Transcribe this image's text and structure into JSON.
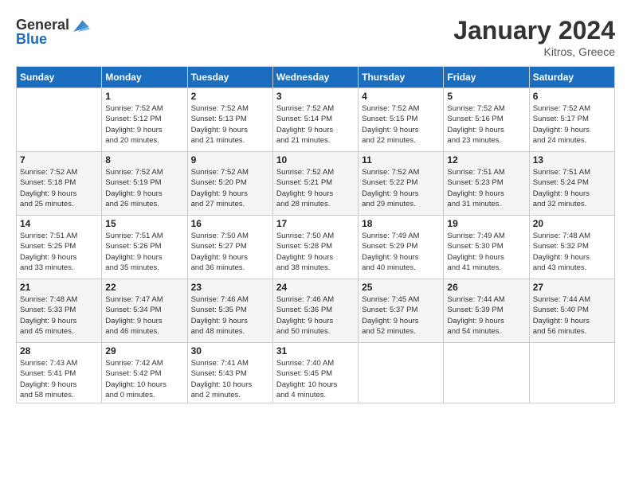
{
  "logo": {
    "text_general": "General",
    "text_blue": "Blue"
  },
  "header": {
    "month_year": "January 2024",
    "location": "Kitros, Greece"
  },
  "weekdays": [
    "Sunday",
    "Monday",
    "Tuesday",
    "Wednesday",
    "Thursday",
    "Friday",
    "Saturday"
  ],
  "weeks": [
    [
      {
        "day": "",
        "info": ""
      },
      {
        "day": "1",
        "info": "Sunrise: 7:52 AM\nSunset: 5:12 PM\nDaylight: 9 hours\nand 20 minutes."
      },
      {
        "day": "2",
        "info": "Sunrise: 7:52 AM\nSunset: 5:13 PM\nDaylight: 9 hours\nand 21 minutes."
      },
      {
        "day": "3",
        "info": "Sunrise: 7:52 AM\nSunset: 5:14 PM\nDaylight: 9 hours\nand 21 minutes."
      },
      {
        "day": "4",
        "info": "Sunrise: 7:52 AM\nSunset: 5:15 PM\nDaylight: 9 hours\nand 22 minutes."
      },
      {
        "day": "5",
        "info": "Sunrise: 7:52 AM\nSunset: 5:16 PM\nDaylight: 9 hours\nand 23 minutes."
      },
      {
        "day": "6",
        "info": "Sunrise: 7:52 AM\nSunset: 5:17 PM\nDaylight: 9 hours\nand 24 minutes."
      }
    ],
    [
      {
        "day": "7",
        "info": "Sunrise: 7:52 AM\nSunset: 5:18 PM\nDaylight: 9 hours\nand 25 minutes."
      },
      {
        "day": "8",
        "info": "Sunrise: 7:52 AM\nSunset: 5:19 PM\nDaylight: 9 hours\nand 26 minutes."
      },
      {
        "day": "9",
        "info": "Sunrise: 7:52 AM\nSunset: 5:20 PM\nDaylight: 9 hours\nand 27 minutes."
      },
      {
        "day": "10",
        "info": "Sunrise: 7:52 AM\nSunset: 5:21 PM\nDaylight: 9 hours\nand 28 minutes."
      },
      {
        "day": "11",
        "info": "Sunrise: 7:52 AM\nSunset: 5:22 PM\nDaylight: 9 hours\nand 29 minutes."
      },
      {
        "day": "12",
        "info": "Sunrise: 7:51 AM\nSunset: 5:23 PM\nDaylight: 9 hours\nand 31 minutes."
      },
      {
        "day": "13",
        "info": "Sunrise: 7:51 AM\nSunset: 5:24 PM\nDaylight: 9 hours\nand 32 minutes."
      }
    ],
    [
      {
        "day": "14",
        "info": "Sunrise: 7:51 AM\nSunset: 5:25 PM\nDaylight: 9 hours\nand 33 minutes."
      },
      {
        "day": "15",
        "info": "Sunrise: 7:51 AM\nSunset: 5:26 PM\nDaylight: 9 hours\nand 35 minutes."
      },
      {
        "day": "16",
        "info": "Sunrise: 7:50 AM\nSunset: 5:27 PM\nDaylight: 9 hours\nand 36 minutes."
      },
      {
        "day": "17",
        "info": "Sunrise: 7:50 AM\nSunset: 5:28 PM\nDaylight: 9 hours\nand 38 minutes."
      },
      {
        "day": "18",
        "info": "Sunrise: 7:49 AM\nSunset: 5:29 PM\nDaylight: 9 hours\nand 40 minutes."
      },
      {
        "day": "19",
        "info": "Sunrise: 7:49 AM\nSunset: 5:30 PM\nDaylight: 9 hours\nand 41 minutes."
      },
      {
        "day": "20",
        "info": "Sunrise: 7:48 AM\nSunset: 5:32 PM\nDaylight: 9 hours\nand 43 minutes."
      }
    ],
    [
      {
        "day": "21",
        "info": "Sunrise: 7:48 AM\nSunset: 5:33 PM\nDaylight: 9 hours\nand 45 minutes."
      },
      {
        "day": "22",
        "info": "Sunrise: 7:47 AM\nSunset: 5:34 PM\nDaylight: 9 hours\nand 46 minutes."
      },
      {
        "day": "23",
        "info": "Sunrise: 7:46 AM\nSunset: 5:35 PM\nDaylight: 9 hours\nand 48 minutes."
      },
      {
        "day": "24",
        "info": "Sunrise: 7:46 AM\nSunset: 5:36 PM\nDaylight: 9 hours\nand 50 minutes."
      },
      {
        "day": "25",
        "info": "Sunrise: 7:45 AM\nSunset: 5:37 PM\nDaylight: 9 hours\nand 52 minutes."
      },
      {
        "day": "26",
        "info": "Sunrise: 7:44 AM\nSunset: 5:39 PM\nDaylight: 9 hours\nand 54 minutes."
      },
      {
        "day": "27",
        "info": "Sunrise: 7:44 AM\nSunset: 5:40 PM\nDaylight: 9 hours\nand 56 minutes."
      }
    ],
    [
      {
        "day": "28",
        "info": "Sunrise: 7:43 AM\nSunset: 5:41 PM\nDaylight: 9 hours\nand 58 minutes."
      },
      {
        "day": "29",
        "info": "Sunrise: 7:42 AM\nSunset: 5:42 PM\nDaylight: 10 hours\nand 0 minutes."
      },
      {
        "day": "30",
        "info": "Sunrise: 7:41 AM\nSunset: 5:43 PM\nDaylight: 10 hours\nand 2 minutes."
      },
      {
        "day": "31",
        "info": "Sunrise: 7:40 AM\nSunset: 5:45 PM\nDaylight: 10 hours\nand 4 minutes."
      },
      {
        "day": "",
        "info": ""
      },
      {
        "day": "",
        "info": ""
      },
      {
        "day": "",
        "info": ""
      }
    ]
  ]
}
